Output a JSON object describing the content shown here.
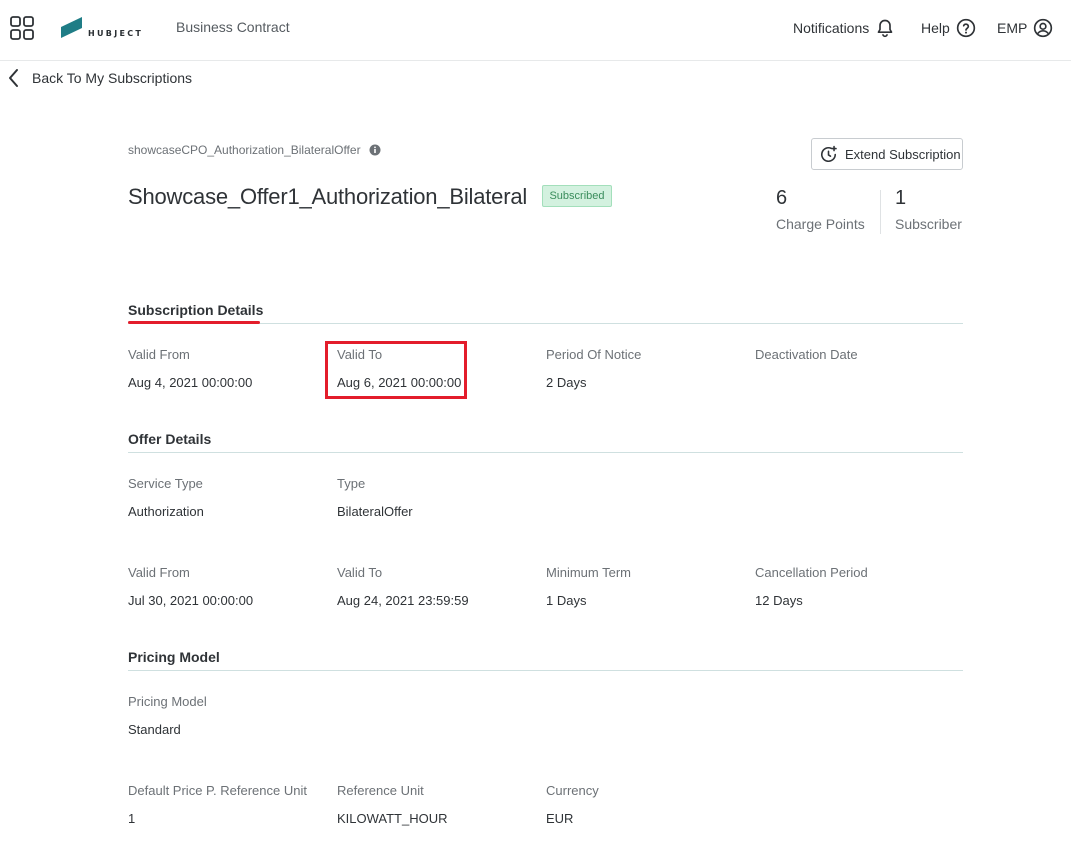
{
  "header": {
    "logo_text": "HUBJECT",
    "app_title": "Business Contract",
    "notifications_label": "Notifications",
    "help_label": "Help",
    "user_label": "EMP"
  },
  "nav": {
    "back_label": "Back To My Subscriptions"
  },
  "offer": {
    "id": "showcaseCPO_Authorization_BilateralOffer",
    "title": "Showcase_Offer1_Authorization_Bilateral",
    "status": "Subscribed",
    "extend_label": "Extend Subscription",
    "stats": [
      {
        "value": "6",
        "label": "Charge Points"
      },
      {
        "value": "1",
        "label": "Subscriber"
      }
    ]
  },
  "subscription_details": {
    "title": "Subscription Details",
    "fields": [
      {
        "label": "Valid From",
        "value": "Aug 4, 2021 00:00:00"
      },
      {
        "label": "Valid To",
        "value": "Aug 6, 2021 00:00:00"
      },
      {
        "label": "Period Of Notice",
        "value": "2 Days"
      },
      {
        "label": "Deactivation Date",
        "value": ""
      }
    ]
  },
  "offer_details": {
    "title": "Offer Details",
    "row1": [
      {
        "label": "Service Type",
        "value": "Authorization"
      },
      {
        "label": "Type",
        "value": "BilateralOffer"
      }
    ],
    "row2": [
      {
        "label": "Valid From",
        "value": "Jul 30, 2021 00:00:00"
      },
      {
        "label": "Valid To",
        "value": "Aug 24, 2021 23:59:59"
      },
      {
        "label": "Minimum Term",
        "value": "1 Days"
      },
      {
        "label": "Cancellation Period",
        "value": "12 Days"
      }
    ]
  },
  "pricing_model": {
    "title": "Pricing Model",
    "row1": [
      {
        "label": "Pricing Model",
        "value": "Standard"
      }
    ],
    "row2": [
      {
        "label": "Default Price P. Reference Unit",
        "value": "1"
      },
      {
        "label": "Reference Unit",
        "value": "KILOWATT_HOUR"
      },
      {
        "label": "Currency",
        "value": "EUR"
      }
    ]
  },
  "colors": {
    "accent_red": "#e31d2b",
    "logo_teal": "#1f7d86",
    "badge_green_bg": "#d3f1df",
    "badge_green_text": "#3a8d5c"
  },
  "icons": {
    "apps": "grid-icon",
    "notifications": "bell-icon",
    "help": "question-circle-icon",
    "user": "user-circle-icon",
    "back": "chevron-left-icon",
    "info": "info-icon",
    "extend": "timer-plus-icon"
  }
}
